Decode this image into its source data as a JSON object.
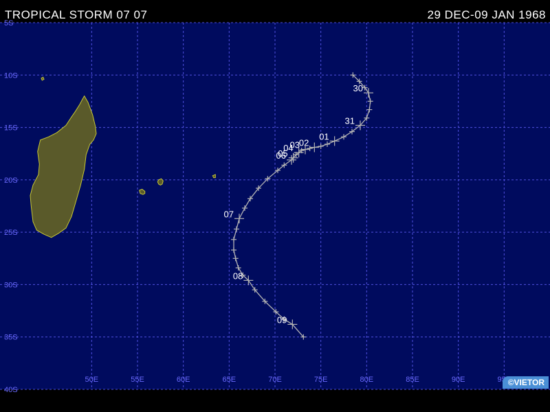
{
  "header": {
    "title": "TROPICAL STORM 07 07",
    "dates": "29 DEC-09 JAN 1968"
  },
  "logo": {
    "text": "©VIETOR"
  },
  "colors": {
    "ocean": "#000b5e",
    "grid": "#5050e0",
    "grid_label": "#6a6aff",
    "land": "#5a5a2a",
    "coast": "#c8c832",
    "track": "#b4b4b4",
    "day_label": "#ffffff"
  },
  "map": {
    "lon_range": [
      40,
      100
    ],
    "lat_range": [
      -40,
      -5
    ],
    "lon_ticks": [
      50,
      55,
      60,
      65,
      70,
      75,
      80,
      85,
      90,
      95
    ],
    "lat_ticks": [
      -5,
      -10,
      -15,
      -20,
      -25,
      -30,
      -35,
      -40
    ],
    "lon_labels": [
      "50E",
      "55E",
      "60E",
      "65E",
      "70E",
      "75E",
      "80E",
      "85E",
      "90E",
      "95E"
    ],
    "lat_labels": [
      "5S",
      "10S",
      "15S",
      "20S",
      "25S",
      "30S",
      "35S",
      "40S"
    ]
  },
  "track": [
    {
      "lon": 78.5,
      "lat": -10.0
    },
    {
      "lon": 79.2,
      "lat": -10.6
    },
    {
      "lon": 79.8,
      "lat": -11.2
    },
    {
      "lon": 80.2,
      "lat": -11.7,
      "label": "30"
    },
    {
      "lon": 80.4,
      "lat": -12.5
    },
    {
      "lon": 80.3,
      "lat": -13.3
    },
    {
      "lon": 80.0,
      "lat": -14.1
    },
    {
      "lon": 79.3,
      "lat": -14.8,
      "label": "31"
    },
    {
      "lon": 78.4,
      "lat": -15.4
    },
    {
      "lon": 77.5,
      "lat": -15.9
    },
    {
      "lon": 76.5,
      "lat": -16.3,
      "label": "01"
    },
    {
      "lon": 75.7,
      "lat": -16.6
    },
    {
      "lon": 75.0,
      "lat": -16.8
    },
    {
      "lon": 74.3,
      "lat": -16.9,
      "label": "02"
    },
    {
      "lon": 73.8,
      "lat": -17.0
    },
    {
      "lon": 73.3,
      "lat": -17.1,
      "label": "03"
    },
    {
      "lon": 72.9,
      "lat": -17.2
    },
    {
      "lon": 72.6,
      "lat": -17.4,
      "label": "04"
    },
    {
      "lon": 72.3,
      "lat": -17.6
    },
    {
      "lon": 72.0,
      "lat": -17.9,
      "label": "05"
    },
    {
      "lon": 71.8,
      "lat": -18.1,
      "label": "06"
    },
    {
      "lon": 71.0,
      "lat": -18.6
    },
    {
      "lon": 70.3,
      "lat": -19.1
    },
    {
      "lon": 69.2,
      "lat": -19.9
    },
    {
      "lon": 68.2,
      "lat": -20.8
    },
    {
      "lon": 67.3,
      "lat": -21.8
    },
    {
      "lon": 66.7,
      "lat": -22.7
    },
    {
      "lon": 66.1,
      "lat": -23.7,
      "label": "07"
    },
    {
      "lon": 65.8,
      "lat": -24.7
    },
    {
      "lon": 65.5,
      "lat": -25.7
    },
    {
      "lon": 65.5,
      "lat": -26.7
    },
    {
      "lon": 65.7,
      "lat": -27.5
    },
    {
      "lon": 66.0,
      "lat": -28.4
    },
    {
      "lon": 66.5,
      "lat": -29.1
    },
    {
      "lon": 67.1,
      "lat": -29.6,
      "label": "08"
    },
    {
      "lon": 67.8,
      "lat": -30.5
    },
    {
      "lon": 68.9,
      "lat": -31.6
    },
    {
      "lon": 70.1,
      "lat": -32.6
    },
    {
      "lon": 71.0,
      "lat": -33.3
    },
    {
      "lon": 71.9,
      "lat": -33.8,
      "label": "09"
    },
    {
      "lon": 73.1,
      "lat": -35.0
    }
  ],
  "land": [
    {
      "name": "madagascar",
      "points": [
        [
          49.2,
          -12.0
        ],
        [
          49.6,
          -12.6
        ],
        [
          50.1,
          -13.8
        ],
        [
          50.4,
          -14.9
        ],
        [
          50.5,
          -15.6
        ],
        [
          50.2,
          -16.2
        ],
        [
          49.8,
          -16.6
        ],
        [
          49.4,
          -17.6
        ],
        [
          49.2,
          -19.0
        ],
        [
          48.8,
          -20.5
        ],
        [
          48.3,
          -22.0
        ],
        [
          47.8,
          -23.5
        ],
        [
          47.2,
          -24.6
        ],
        [
          46.4,
          -25.1
        ],
        [
          45.6,
          -25.5
        ],
        [
          44.8,
          -25.2
        ],
        [
          44.0,
          -24.8
        ],
        [
          43.6,
          -24.0
        ],
        [
          43.4,
          -22.5
        ],
        [
          43.3,
          -21.5
        ],
        [
          43.6,
          -20.5
        ],
        [
          44.2,
          -19.5
        ],
        [
          44.3,
          -18.5
        ],
        [
          44.1,
          -17.3
        ],
        [
          44.4,
          -16.2
        ],
        [
          45.3,
          -15.9
        ],
        [
          46.2,
          -15.5
        ],
        [
          47.2,
          -14.8
        ],
        [
          47.8,
          -14.0
        ],
        [
          48.2,
          -13.5
        ],
        [
          48.7,
          -12.8
        ],
        [
          49.0,
          -12.3
        ]
      ]
    },
    {
      "name": "reunion",
      "points": [
        [
          55.2,
          -21.0
        ],
        [
          55.5,
          -20.9
        ],
        [
          55.8,
          -21.1
        ],
        [
          55.8,
          -21.3
        ],
        [
          55.6,
          -21.4
        ],
        [
          55.3,
          -21.3
        ]
      ]
    },
    {
      "name": "mauritius",
      "points": [
        [
          57.3,
          -20.0
        ],
        [
          57.6,
          -19.9
        ],
        [
          57.8,
          -20.1
        ],
        [
          57.7,
          -20.4
        ],
        [
          57.5,
          -20.5
        ],
        [
          57.3,
          -20.4
        ],
        [
          57.2,
          -20.2
        ]
      ]
    },
    {
      "name": "islet-a",
      "points": [
        [
          44.5,
          -10.3
        ],
        [
          44.7,
          -10.2
        ],
        [
          44.8,
          -10.4
        ],
        [
          44.6,
          -10.5
        ]
      ]
    },
    {
      "name": "islet-b",
      "points": [
        [
          63.2,
          -19.6
        ],
        [
          63.5,
          -19.5
        ],
        [
          63.5,
          -19.8
        ],
        [
          63.3,
          -19.8
        ]
      ]
    }
  ]
}
